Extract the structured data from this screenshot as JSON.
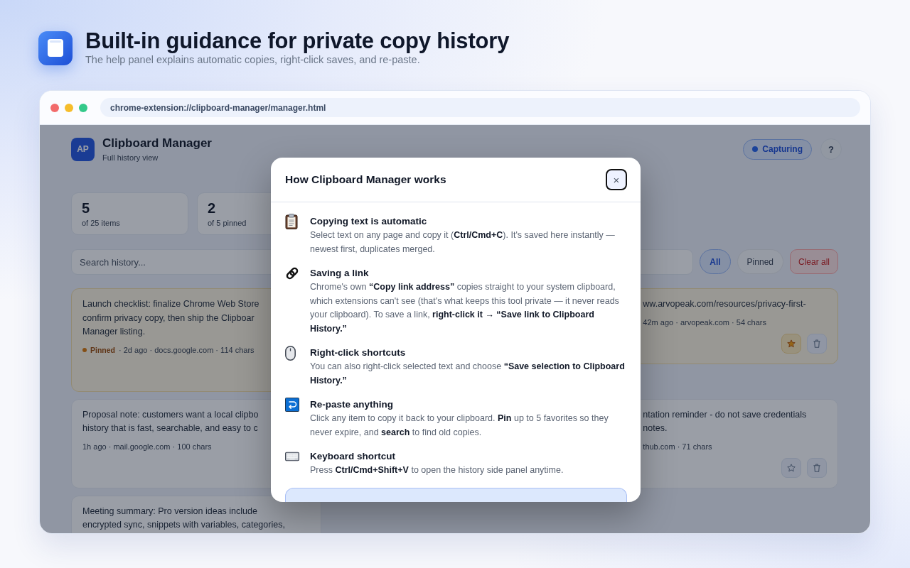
{
  "hero": {
    "title": "Built-in guidance for private copy history",
    "subtitle": "The help panel explains automatic copies, right-click saves, and re-paste."
  },
  "browser": {
    "url": "chrome-extension://clipboard-manager/manager.html"
  },
  "app": {
    "logo": "AP",
    "title": "Clipboard Manager",
    "subtitle": "Full history view",
    "status": {
      "label": "Capturing"
    },
    "help_button": "?",
    "stats": [
      {
        "value": "5",
        "label": "of 25 items"
      },
      {
        "value": "2",
        "label": "of 5 pinned"
      }
    ],
    "search": {
      "placeholder": "Search history..."
    },
    "filters": [
      {
        "label": "All",
        "selected": true
      },
      {
        "label": "Pinned",
        "selected": false
      }
    ],
    "clear_button": "Clear all",
    "left_column_items": [
      {
        "pinned": true,
        "lines": [
          "Launch checklist: finalize Chrome Web Store",
          "confirm privacy copy, then ship the Clipboar",
          "Manager listing."
        ],
        "badge": "Pinned",
        "meta": "· 2d ago · docs.google.com · 114 chars"
      },
      {
        "pinned": false,
        "lines": [
          "Proposal note: customers want a local clipbo",
          "history that is fast, searchable, and easy to c"
        ],
        "meta": "1h ago · mail.google.com · 100 chars"
      },
      {
        "pinned": false,
        "lines": [
          "Meeting summary: Pro version ideas include",
          "encrypted sync, snippets with variables, categories,"
        ]
      }
    ],
    "right_column_items": [
      {
        "pinned": true,
        "lines": [
          "ww.arvopeak.com/resources/privacy-first-"
        ],
        "meta": "42m ago · arvopeak.com · 54 chars"
      },
      {
        "pinned": false,
        "lines": [
          "ntation reminder - do not save credentials",
          "notes."
        ],
        "meta": "thub.com · 71 chars"
      }
    ]
  },
  "help_dialog": {
    "title": "How Clipboard Manager works",
    "close": "×",
    "sections": [
      {
        "title": "Copying text is automatic",
        "text": "Select text on any page and copy it (**Ctrl/Cmd+C**). It's saved here instantly — newest first, duplicates merged."
      },
      {
        "title": "Saving a link",
        "text": "Chrome's own **“Copy link address”** copies straight to your system clipboard, which extensions can't see (that's what keeps this tool private — it never reads your clipboard). To save a link, **right-click it → “Save link to Clipboard History.”**"
      },
      {
        "title": "Right-click shortcuts",
        "text": "You can also right-click selected text and choose **“Save selection to Clipboard History.”**"
      },
      {
        "title": "Re-paste anything",
        "text": "Click any item to copy it back to your clipboard. **Pin** up to 5 favorites so they never expire, and **search** to find old copies."
      },
      {
        "title": "Keyboard shortcut",
        "text": "Press **Ctrl/Cmd+Shift+V** to open the history side panel anytime."
      }
    ]
  }
}
